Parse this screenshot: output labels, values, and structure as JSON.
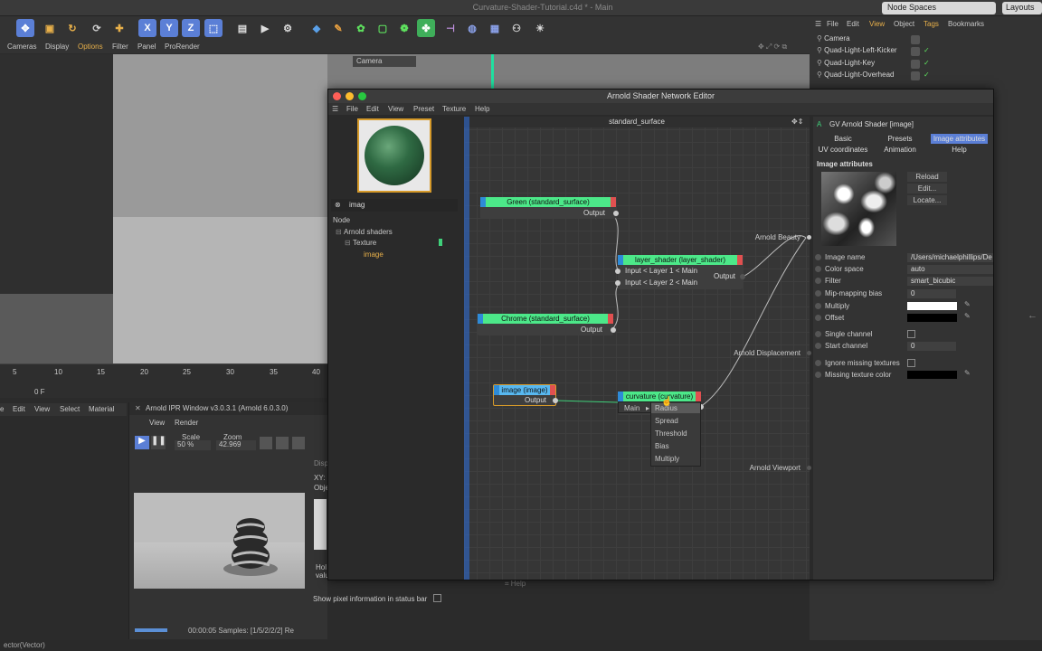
{
  "app": {
    "title": "Curvature-Shader-Tutorial.c4d * - Main",
    "node_spaces": "Node Spaces",
    "layouts": "Layouts",
    "status": "ector(Vector)"
  },
  "viewport_menu": [
    "Cameras",
    "Display",
    "Options",
    "Filter",
    "Panel",
    "ProRender"
  ],
  "viewport": {
    "camera_label": "Camera"
  },
  "timeline": {
    "ticks": [
      "5",
      "10",
      "15",
      "20",
      "25",
      "30",
      "35",
      "40"
    ],
    "frame": "0 F"
  },
  "material_menu": [
    "e",
    "Edit",
    "View",
    "Select",
    "Material"
  ],
  "ipr": {
    "title": "Arnold IPR Window v3.0.3.1 (Arnold 6.0.3.0)",
    "menu": [
      "View",
      "Render"
    ],
    "scale_label": "Scale",
    "zoom_label": "Zoom",
    "scale_value": "50 %",
    "zoom_value": "42.969",
    "side_labels": [
      "Disp",
      "XY:",
      "Obje",
      "Hol",
      "valu"
    ],
    "show_pixel_info": "Show pixel information in status bar",
    "footer": "00:00:05  Samples: [1/5/2/2/2]  Re",
    "help": "Help"
  },
  "objects_menu": [
    "File",
    "Edit",
    "View",
    "Object",
    "Tags",
    "Bookmarks"
  ],
  "objects": [
    "Camera",
    "Quad-Light-Left-Kicker",
    "Quad-Light-Key",
    "Quad-Light-Overhead"
  ],
  "editor": {
    "title": "Arnold Shader Network Editor",
    "menu": [
      "File",
      "Edit",
      "View",
      "Preset",
      "Texture",
      "Help"
    ],
    "search_value": "imag",
    "tree": {
      "header": "Node",
      "root": "Arnold shaders",
      "category": "Texture",
      "item": "image"
    },
    "canvas_title": "standard_surface",
    "nodes": {
      "green": {
        "title": "Green (standard_surface)",
        "output": "Output"
      },
      "layer": {
        "title": "layer_shader (layer_shader)",
        "in1": "Input < Layer 1 < Main",
        "in2": "Input < Layer 2 < Main",
        "output": "Output"
      },
      "chrome": {
        "title": "Chrome (standard_surface)",
        "output": "Output"
      },
      "image": {
        "title": "image (image)",
        "output": "Output"
      },
      "curvature": {
        "title": "curvature (curvature)"
      }
    },
    "root_ports": [
      "Arnold Beauty",
      "Arnold Displacement",
      "Arnold Viewport"
    ],
    "context_menu": {
      "main": "Main",
      "items": [
        "Radius",
        "Spread",
        "Threshold",
        "Bias",
        "Multiply"
      ]
    }
  },
  "attributes": {
    "header": "GV Arnold Shader [image]",
    "tabs": [
      "Basic",
      "Presets",
      "Image attributes",
      "UV coordinates",
      "Animation",
      "Help"
    ],
    "section": "Image attributes",
    "buttons": [
      "Reload",
      "Edit...",
      "Locate..."
    ],
    "fields": [
      {
        "label": "Image name",
        "value": "/Users/michaelphillips/De"
      },
      {
        "label": "Color space",
        "value": "auto"
      },
      {
        "label": "Filter",
        "value": "smart_bicubic"
      },
      {
        "label": "Mip-mapping bias",
        "value": "0"
      },
      {
        "label": "Multiply",
        "value": ""
      },
      {
        "label": "Offset",
        "value": ""
      },
      {
        "label": "Single channel",
        "value": ""
      },
      {
        "label": "Start channel",
        "value": "0"
      },
      {
        "label": "Ignore missing textures",
        "value": ""
      },
      {
        "label": "Missing texture color",
        "value": ""
      }
    ]
  },
  "colors": {
    "node_header": "#4ce889",
    "accent_orange": "#d69a2a",
    "link_green": "#3fd07a",
    "selected_tab": "#5b7fd6"
  }
}
